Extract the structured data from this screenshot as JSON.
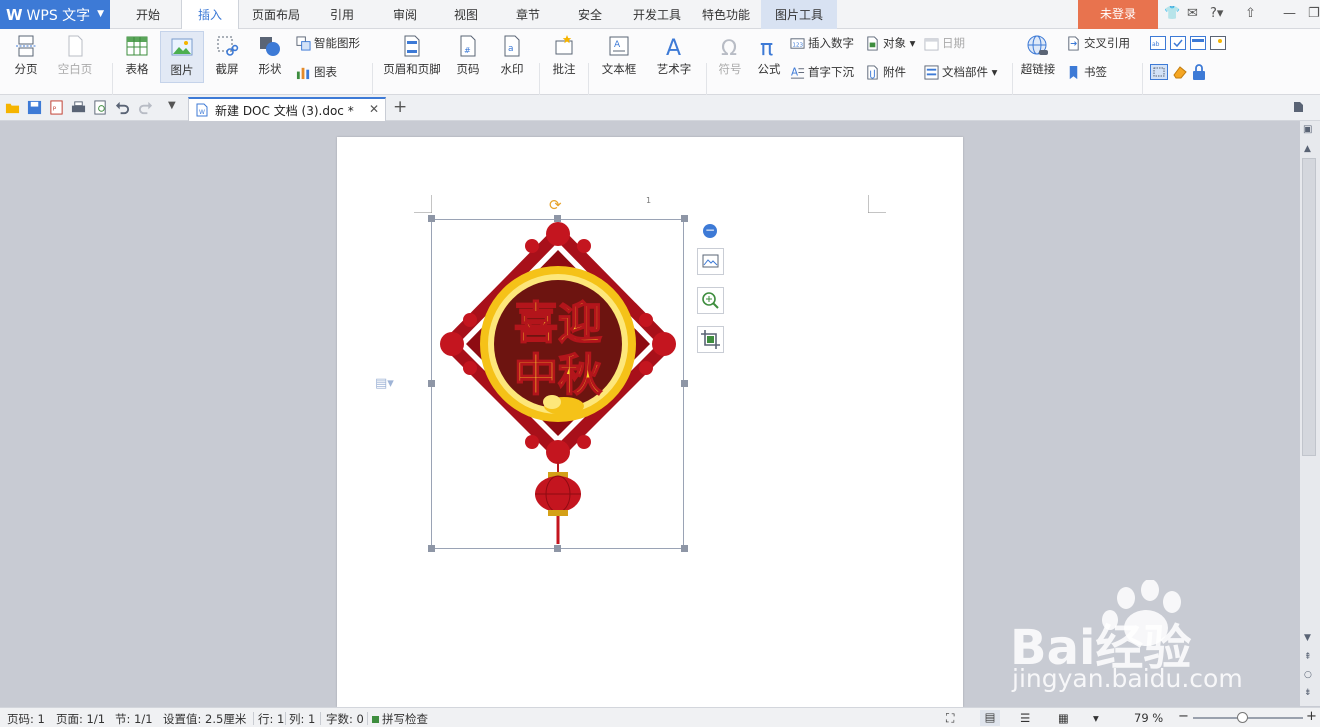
{
  "app": {
    "name": "WPS 文字",
    "login_label": "未登录"
  },
  "menu": {
    "tabs": [
      {
        "label": "开始",
        "active": false
      },
      {
        "label": "插入",
        "active": true
      },
      {
        "label": "页面布局",
        "active": false
      },
      {
        "label": "引用",
        "active": false
      },
      {
        "label": "审阅",
        "active": false
      },
      {
        "label": "视图",
        "active": false
      },
      {
        "label": "章节",
        "active": false
      },
      {
        "label": "安全",
        "active": false
      },
      {
        "label": "开发工具",
        "active": false
      },
      {
        "label": "特色功能",
        "active": false
      },
      {
        "label": "图片工具",
        "active": false
      }
    ]
  },
  "ribbon": {
    "page_break": "分页",
    "blank_page": "空白页",
    "table": "表格",
    "picture": "图片",
    "screenshot": "截屏",
    "shapes": "形状",
    "smart_art": "智能图形",
    "chart": "图表",
    "header_footer": "页眉和页脚",
    "page_number": "页码",
    "watermark": "水印",
    "comment": "批注",
    "textbox": "文本框",
    "word_art": "艺术字",
    "symbol": "符号",
    "equation": "公式",
    "insert_number": "插入数字",
    "drop_cap": "首字下沉",
    "object": "对象",
    "attachment": "附件",
    "date": "日期",
    "doc_parts": "文档部件",
    "hyperlink": "超链接",
    "cross_ref": "交叉引用",
    "bookmark": "书签"
  },
  "doc_tab": {
    "title": "新建 DOC 文档 (3).doc *"
  },
  "page": {
    "page_marker": "1"
  },
  "image": {
    "line1": "喜迎",
    "line2": "中秋"
  },
  "status": {
    "page": "页码: 1",
    "pages": "页面: 1/1",
    "section": "节: 1/1",
    "setting": "设置值: 2.5厘米",
    "row": "行: 1",
    "col": "列: 1",
    "words": "字数: 0",
    "spell": "拼写检查",
    "zoom": "79 %",
    "zoom_fraction": 0.79
  },
  "watermark": {
    "brand": "Bai经验",
    "url": "jingyan.baidu.com"
  },
  "colors": {
    "accent": "#3d7ad6",
    "login": "#e8734e",
    "ornament_red": "#b3151b",
    "ornament_gold": "#f5c218"
  }
}
